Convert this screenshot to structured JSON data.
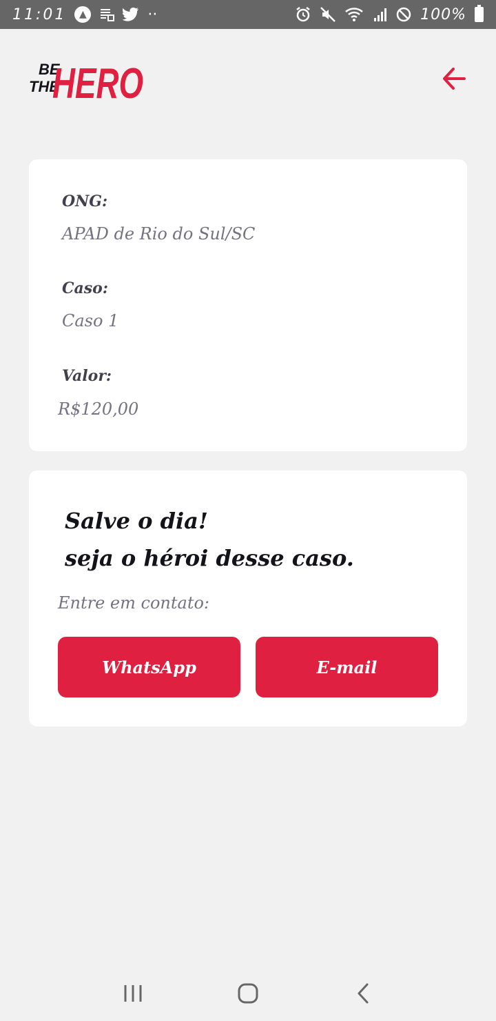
{
  "status_bar": {
    "time": "11:01",
    "left_icons": [
      "app-icon",
      "stack-icon",
      "twitter-icon",
      "more-dots-icon"
    ],
    "right_icons": [
      "alarm-icon",
      "mute-icon",
      "wifi-icon",
      "signal-icon",
      "block-icon"
    ],
    "battery_percent": "100%"
  },
  "header": {
    "logo_small_top": "BE",
    "logo_small_bottom": "THE",
    "logo_big": "HERO",
    "back_icon": "arrow-left-icon"
  },
  "incident": {
    "ong_label": "ONG:",
    "ong_value": "APAD de  Rio do Sul/SC",
    "case_label": "Caso:",
    "case_value": "Caso 1",
    "value_label": "Valor:",
    "value_value": "R$120,00"
  },
  "contact": {
    "title_line1": "Salve o dia!",
    "title_line2": "seja o héroi desse caso.",
    "subtitle": "Entre em contato:",
    "whatsapp_label": "WhatsApp",
    "email_label": "E-mail"
  },
  "nav_bar": {
    "icons": [
      "recent-apps-icon",
      "home-icon",
      "back-icon"
    ]
  },
  "colors": {
    "brand_red": "#e02041",
    "background": "#f1f1f1",
    "card": "#ffffff",
    "label_text": "#41414d",
    "value_text": "#737380",
    "status_bar": "#666666"
  }
}
